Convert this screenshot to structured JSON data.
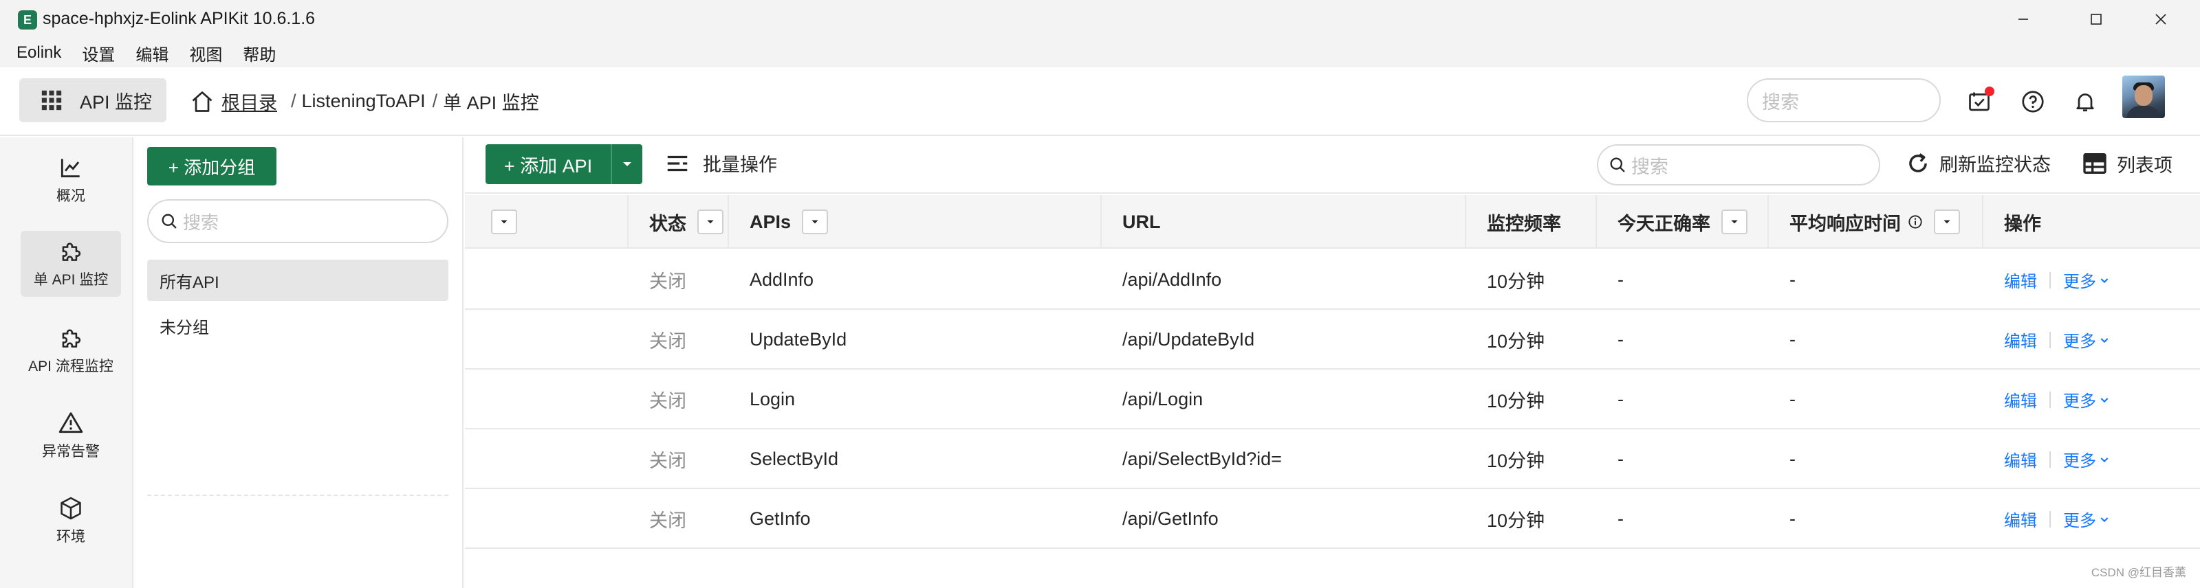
{
  "window": {
    "title": "space-hphxjz-Eolink APIKit 10.6.1.6",
    "logo_glyph": "E"
  },
  "menu": [
    "Eolink",
    "设置",
    "编辑",
    "视图",
    "帮助"
  ],
  "header": {
    "module_label": "API 监控",
    "breadcrumb": {
      "root": "根目录",
      "items": [
        "ListeningToAPI",
        "单 API 监控"
      ],
      "separator": "/"
    },
    "search_placeholder": "搜索"
  },
  "leftnav": [
    {
      "label": "概况",
      "icon": "line-chart-icon"
    },
    {
      "label": "单 API 监控",
      "icon": "puzzle-icon",
      "active": true
    },
    {
      "label": "API 流程监控",
      "icon": "puzzle-icon"
    },
    {
      "label": "异常告警",
      "icon": "warning-icon"
    },
    {
      "label": "环境",
      "icon": "cube-icon"
    }
  ],
  "groups": {
    "add_label": "+ 添加分组",
    "search_placeholder": "搜索",
    "items": [
      {
        "label": "所有API",
        "active": true
      },
      {
        "label": "未分组"
      }
    ]
  },
  "toolbar": {
    "add_api_label": "+ 添加 API",
    "batch_label": "批量操作",
    "search_placeholder": "搜索",
    "refresh_label": "刷新监控状态",
    "columns_label": "列表项"
  },
  "table": {
    "columns": {
      "status": "状态",
      "apis": "APIs",
      "url": "URL",
      "frequency": "监控频率",
      "accuracy": "今天正确率",
      "avg_response": "平均响应时间",
      "actions": "操作"
    },
    "rows": [
      {
        "status": "关闭",
        "api": "AddInfo",
        "url": "/api/AddInfo",
        "frequency": "10分钟",
        "accuracy": "-",
        "avg_response": "-"
      },
      {
        "status": "关闭",
        "api": "UpdateById",
        "url": "/api/UpdateById",
        "frequency": "10分钟",
        "accuracy": "-",
        "avg_response": "-"
      },
      {
        "status": "关闭",
        "api": "Login",
        "url": "/api/Login",
        "frequency": "10分钟",
        "accuracy": "-",
        "avg_response": "-"
      },
      {
        "status": "关闭",
        "api": "SelectById",
        "url": "/api/SelectById?id=",
        "frequency": "10分钟",
        "accuracy": "-",
        "avg_response": "-"
      },
      {
        "status": "关闭",
        "api": "GetInfo",
        "url": "/api/GetInfo",
        "frequency": "10分钟",
        "accuracy": "-",
        "avg_response": "-"
      }
    ],
    "action_edit": "编辑",
    "action_more": "更多"
  },
  "watermark": "CSDN @红目香薰",
  "colors": {
    "primary_green": "#1a7a4c",
    "link_blue": "#1677ff",
    "notification_red": "#f5222d"
  }
}
